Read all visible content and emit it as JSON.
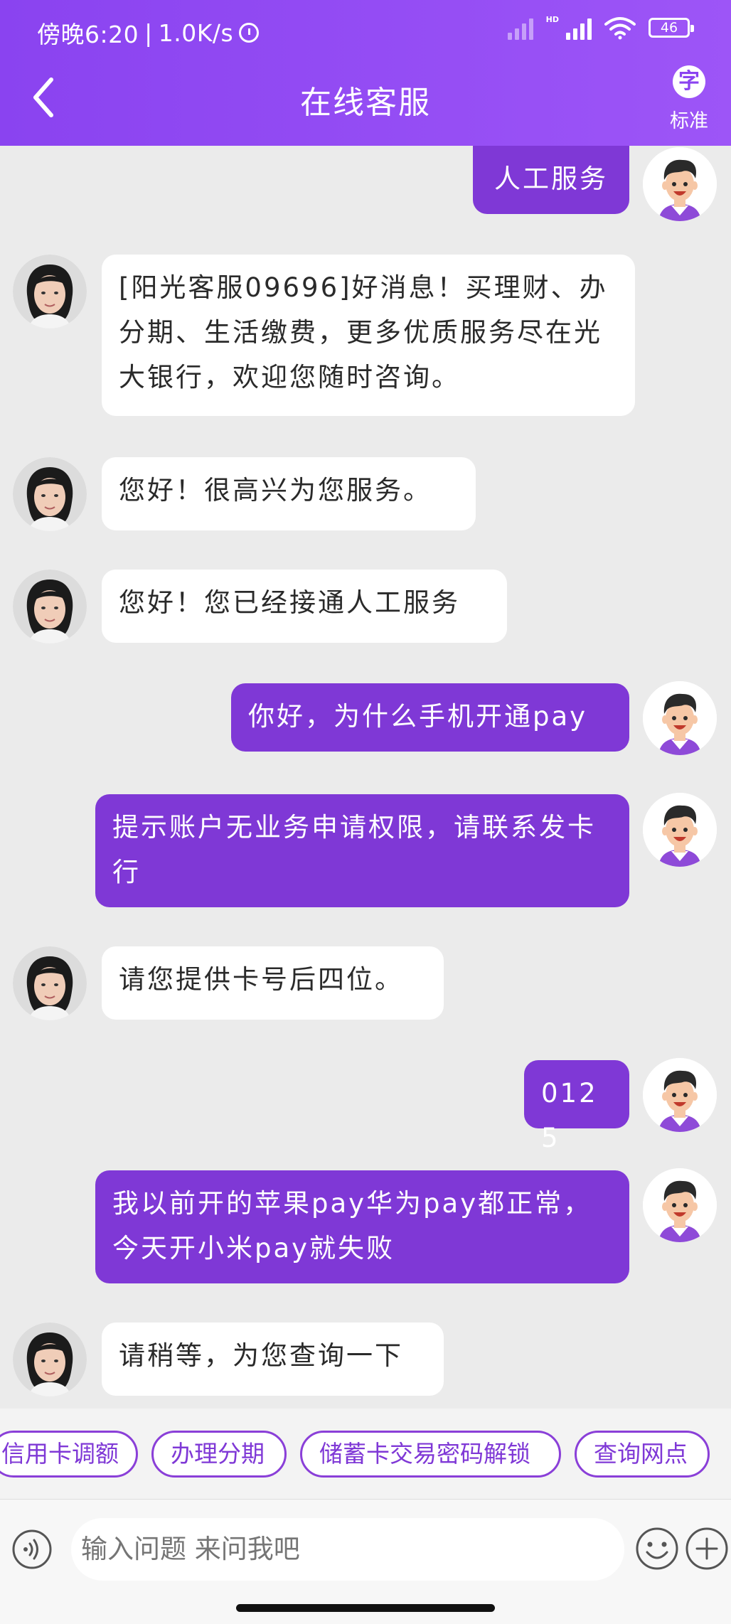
{
  "status_bar": {
    "time": "傍晚6:20",
    "speed": "1.0K/s",
    "network_label": "HD",
    "battery": "46"
  },
  "header": {
    "title": "在线客服",
    "font_icon_char": "字",
    "font_label": "标准"
  },
  "messages": [
    {
      "from": "user",
      "text": "人工服务"
    },
    {
      "from": "agent",
      "text": "[阳光客服09696]好消息！买理财、办分期、生活缴费，更多优质服务尽在光大银行，欢迎您随时咨询。"
    },
    {
      "from": "agent",
      "text": "您好！很高兴为您服务。"
    },
    {
      "from": "agent",
      "text": "您好！您已经接通人工服务"
    },
    {
      "from": "user",
      "text": "你好，为什么手机开通pay"
    },
    {
      "from": "user",
      "text": "提示账户无业务申请权限，请联系发卡行"
    },
    {
      "from": "agent",
      "text": "请您提供卡号后四位。"
    },
    {
      "from": "user",
      "text": "0125"
    },
    {
      "from": "user",
      "text": "我以前开的苹果pay华为pay都正常，今天开小米pay就失败"
    },
    {
      "from": "agent",
      "text": "请稍等，为您查询一下"
    }
  ],
  "quick_replies": [
    "信用卡调额",
    "办理分期",
    "储蓄卡交易密码解锁",
    "查询网点"
  ],
  "input": {
    "placeholder": "输入问题 来问我吧"
  },
  "icons": {
    "back": "chevron-left-icon",
    "voice": "voice-icon",
    "emoji": "emoji-icon",
    "plus": "plus-icon"
  },
  "colors": {
    "header": "#9650f5",
    "user_bubble": "#7f38d6",
    "agent_bubble": "#ffffff",
    "background": "#ebebeb"
  }
}
